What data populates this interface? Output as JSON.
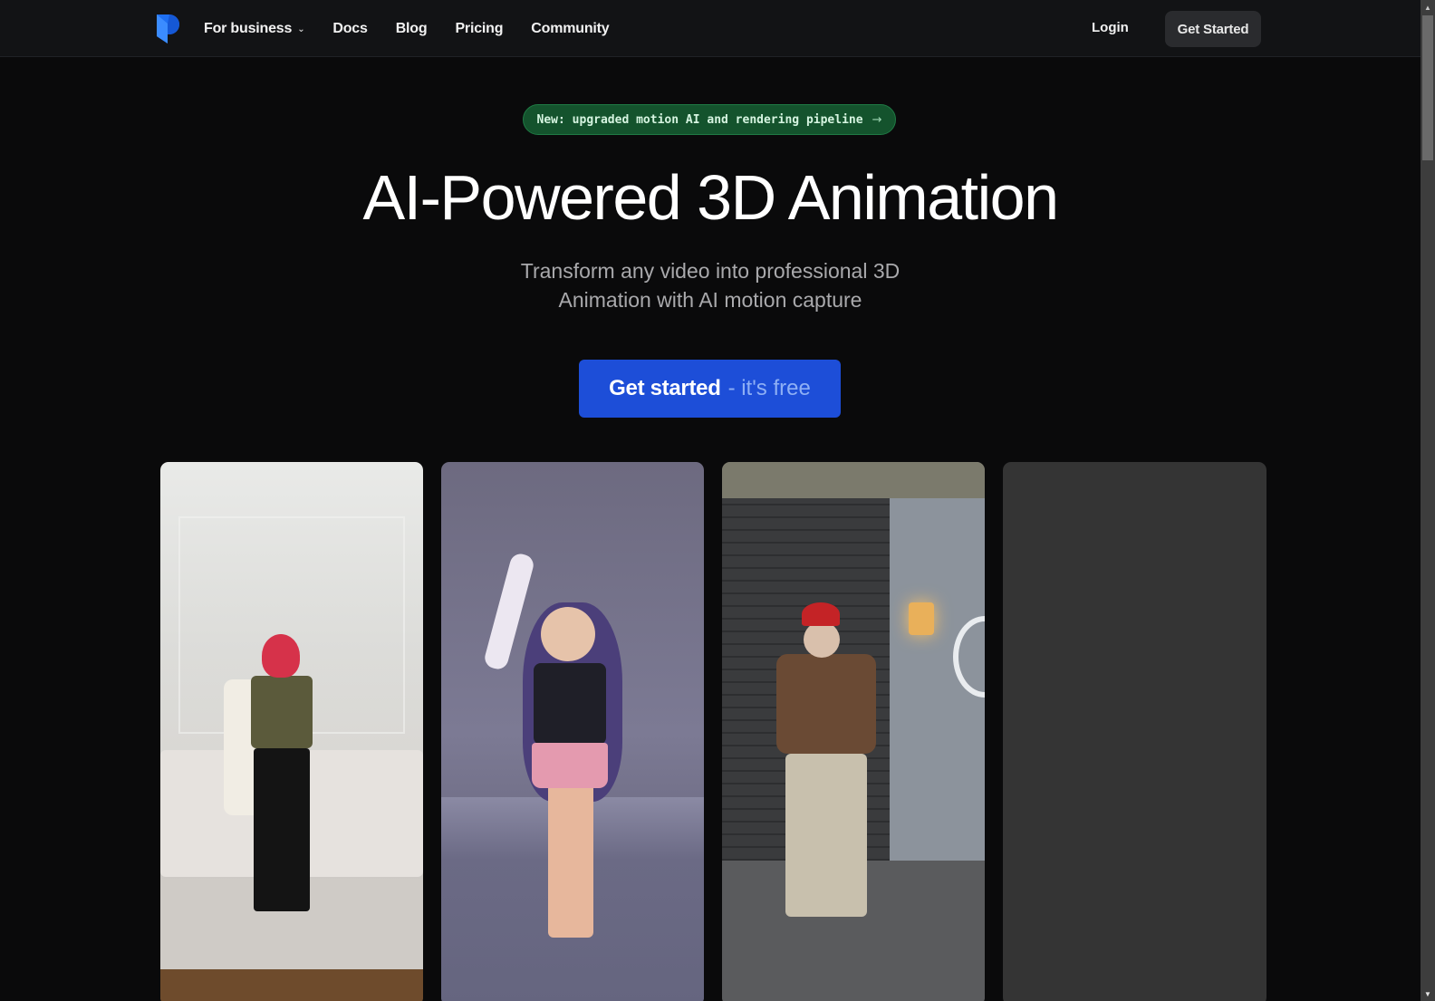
{
  "header": {
    "logo_name": "brand-logo",
    "nav": [
      {
        "label": "For business",
        "has_dropdown": true
      },
      {
        "label": "Docs"
      },
      {
        "label": "Blog"
      },
      {
        "label": "Pricing"
      },
      {
        "label": "Community"
      }
    ],
    "dropdown_glyph": "⌄",
    "login_label": "Login",
    "get_started_label": "Get Started"
  },
  "announcement": {
    "text": "New: upgraded motion AI and rendering pipeline",
    "arrow": "→"
  },
  "hero": {
    "title": "AI-Powered 3D Animation",
    "subtitle_line1": "Transform any video into professional 3D",
    "subtitle_line2": "Animation with AI motion capture",
    "cta_main": "Get started",
    "cta_sub": "- it's free"
  },
  "showcase": {
    "cards": [
      {
        "description": "Woman with red hair and headphones dancing in living room"
      },
      {
        "description": "3D anime character mirroring the dance"
      },
      {
        "description": "Older man in red beanie dancing by brick fireplace"
      },
      {
        "description": "Loading video placeholder"
      }
    ]
  },
  "colors": {
    "background": "#0a0a0b",
    "header_bg": "#121315",
    "brand_blue": "#1d4ed8",
    "pill_green": "#14532d",
    "placeholder_gray": "#343434"
  },
  "scrollbar": {
    "up_glyph": "▲",
    "down_glyph": "▼"
  }
}
